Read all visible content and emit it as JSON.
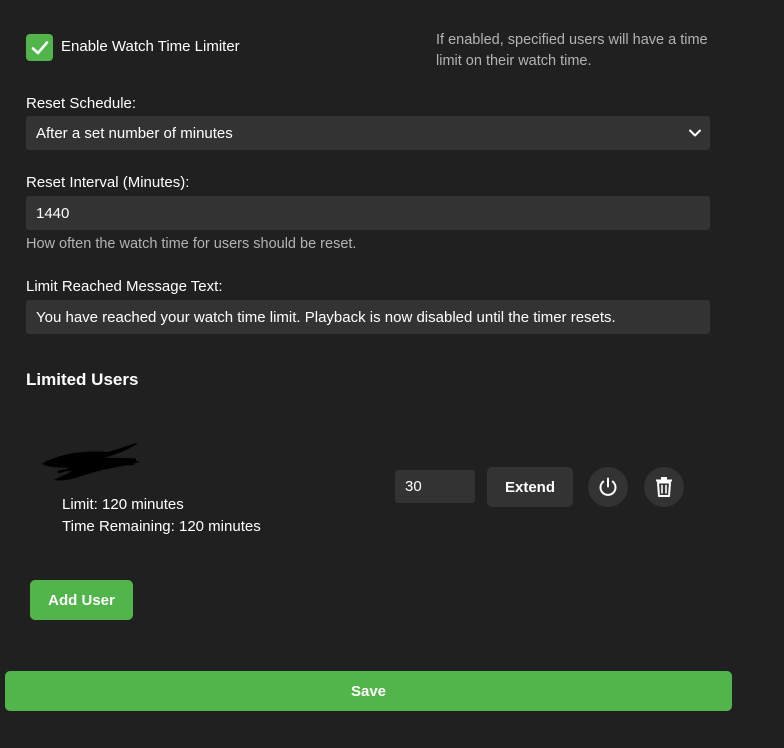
{
  "enable": {
    "checked": true,
    "label": "Enable Watch Time Limiter",
    "helper": "If enabled, specified users will have a time limit on their watch time."
  },
  "reset_schedule": {
    "label": "Reset Schedule:",
    "selected": "After a set number of minutes"
  },
  "reset_interval": {
    "label": "Reset Interval (Minutes):",
    "value": "1440",
    "helper": "How often the watch time for users should be reset."
  },
  "limit_message": {
    "label": "Limit Reached Message Text:",
    "value": "You have reached your watch time limit. Playback is now disabled until the timer resets."
  },
  "limited_users": {
    "title": "Limited Users",
    "users": [
      {
        "limit": "Limit: 120 minutes",
        "remaining": "Time Remaining: 120 minutes",
        "extend_value": "30",
        "extend_label": "Extend"
      }
    ],
    "add_user_label": "Add User"
  },
  "save_label": "Save",
  "colors": {
    "background": "#202020",
    "input": "#333333",
    "accent": "#52b54b",
    "muted_text": "#b3b3b3"
  },
  "icons": {
    "checkbox": "check-icon",
    "dropdown": "chevron-down-icon",
    "power": "power-icon",
    "delete": "trash-icon"
  }
}
